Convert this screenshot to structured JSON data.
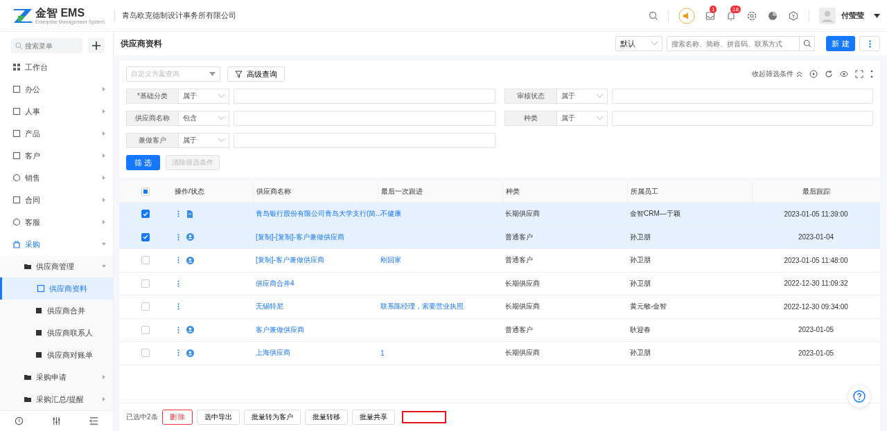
{
  "header": {
    "logo_text": "金智 EMS",
    "logo_sub": "Enterprise Management System",
    "company": "青岛欧克德制设计事务所有限公司",
    "badges": [
      {
        "kind": "inbox",
        "count": "1"
      },
      {
        "kind": "bell",
        "count": "18"
      }
    ],
    "user": "付莹莹"
  },
  "sidebar": {
    "search_placeholder": "搜索菜单",
    "items": [
      {
        "kind": "grid",
        "label": "工作台",
        "expandable": false,
        "expanded": false,
        "selected": false
      },
      {
        "kind": "office",
        "label": "办公",
        "expandable": true,
        "expanded": false,
        "selected": false
      },
      {
        "kind": "people",
        "label": "人事",
        "expandable": true,
        "expanded": false,
        "selected": false
      },
      {
        "kind": "cube",
        "label": "产品",
        "expandable": true,
        "expanded": false,
        "selected": false
      },
      {
        "kind": "chart",
        "label": "客户",
        "expandable": true,
        "expanded": false,
        "selected": false
      },
      {
        "kind": "circle",
        "label": "销售",
        "expandable": true,
        "expanded": false,
        "selected": false
      },
      {
        "kind": "doc",
        "label": "合同",
        "expandable": true,
        "expanded": false,
        "selected": false
      },
      {
        "kind": "headset",
        "label": "客服",
        "expandable": true,
        "expanded": false,
        "selected": false
      },
      {
        "kind": "bag",
        "label": "采购",
        "expandable": true,
        "expanded": true,
        "selected": false,
        "children": [
          {
            "kind": "folder",
            "label": "供应商管理",
            "expandable": true,
            "expanded": true,
            "selected": false,
            "children": [
              {
                "kind": "card",
                "label": "供应商资料",
                "expandable": false,
                "expanded": false,
                "selected": true
              },
              {
                "kind": "merge",
                "label": "供应商合并",
                "expandable": false,
                "expanded": false,
                "selected": false
              },
              {
                "kind": "contact",
                "label": "供应商联系人",
                "expandable": false,
                "expanded": false,
                "selected": false
              },
              {
                "kind": "stamp",
                "label": "供应商对账单",
                "expandable": false,
                "expanded": false,
                "selected": false
              }
            ]
          },
          {
            "kind": "folder",
            "label": "采购申请",
            "expandable": true,
            "expanded": false,
            "selected": false
          },
          {
            "kind": "folder",
            "label": "采购汇总/提醒",
            "expandable": true,
            "expanded": false,
            "selected": false
          }
        ]
      }
    ]
  },
  "page": {
    "title": "供应商资料",
    "view_select": "默认",
    "search_placeholder": "搜索名称、简称、拼音码、联系方式",
    "new_button": "新 建"
  },
  "filters": {
    "scheme_placeholder": "自定义方案查询",
    "advanced_button": "高级查询",
    "collapse_link": "收起筛选条件",
    "conditions": [
      [
        {
          "label": "*基础分类",
          "operator": "属于"
        },
        {
          "label": "审核状态",
          "operator": "属于"
        }
      ],
      [
        {
          "label": "供应商名称",
          "operator": "包含"
        },
        {
          "label": "种类",
          "operator": "属于"
        }
      ],
      [
        {
          "label": "兼做客户",
          "operator": "属于"
        }
      ]
    ],
    "apply_button": "筛 选",
    "clear_button": "清除筛选条件"
  },
  "table": {
    "select_all_indeterminate": true,
    "columns": [
      "操作/状态",
      "供应商名称",
      "最后一次跟进",
      "种类",
      "所属员工",
      "最后跟踪"
    ],
    "rows": [
      {
        "checked": true,
        "kind": "doc",
        "name": "青岛银行股份有限公司青岛大学支行(简...",
        "followup": "不健康",
        "type": "长期供应商",
        "staff": "金智CRM—于颖",
        "last": "2023-01-05 11:39:00"
      },
      {
        "checked": true,
        "kind": "person",
        "name": "[复制]-[复制]-客户兼做供应商",
        "followup": "",
        "type": "普通客户",
        "staff": "孙卫朋",
        "last": "2023-01-04"
      },
      {
        "checked": false,
        "kind": "person",
        "name": "[复制]-客户兼做供应商",
        "followup": "刚回家",
        "type": "普通客户",
        "staff": "孙卫朋",
        "last": "2023-01-05 11:48:00"
      },
      {
        "checked": false,
        "kind": "plain",
        "name": "供应商合并4",
        "followup": "",
        "type": "长期供应商",
        "staff": "孙卫朋",
        "last": "2022-12-30 11:09:32"
      },
      {
        "checked": false,
        "kind": "plain",
        "name": "无锡特尼",
        "followup": "联系陈经理，索要营业执照",
        "type": "长期供应商",
        "staff": "黄元敏-金智",
        "last": "2022-12-30 09:34:00"
      },
      {
        "checked": false,
        "kind": "person",
        "name": "客户兼做供应商",
        "followup": "",
        "type": "普通客户",
        "staff": "耿迎春",
        "last": "2023-01-05"
      },
      {
        "checked": false,
        "kind": "person",
        "name": "上海供应商",
        "followup": "1",
        "type": "长期供应商",
        "staff": "孙卫朋",
        "last": "2023-01-05"
      }
    ]
  },
  "footer": {
    "selected_count": "已选中2条",
    "buttons": [
      {
        "kind": "danger",
        "label": "删 除"
      },
      {
        "kind": "normal",
        "label": "选中导出"
      },
      {
        "kind": "normal",
        "label": "批量转为客户"
      },
      {
        "kind": "normal",
        "label": "批量转移"
      },
      {
        "kind": "normal",
        "label": "批量共享"
      }
    ]
  }
}
